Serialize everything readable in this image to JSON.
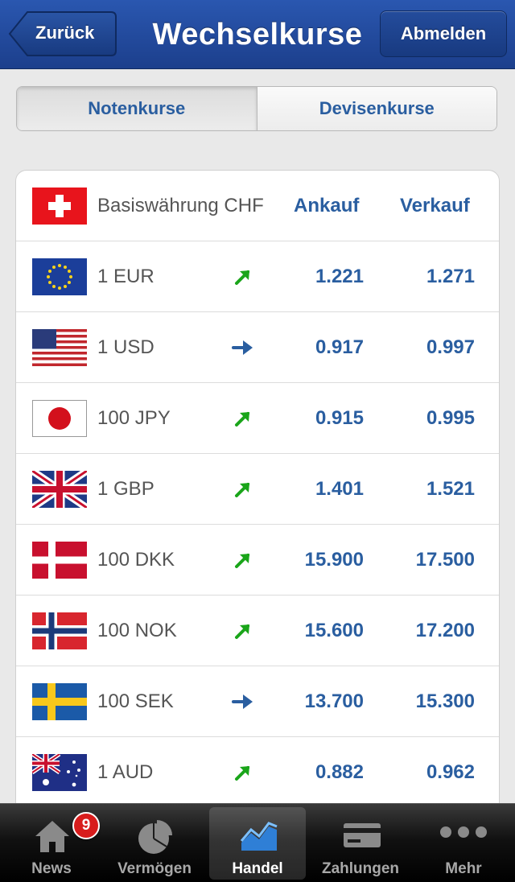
{
  "nav": {
    "title": "Wechselkurse",
    "back_label": "Zurück",
    "logout_label": "Abmelden"
  },
  "segments": [
    "Notenkurse",
    "Devisenkurse"
  ],
  "table": {
    "base_label": "Basiswährung CHF",
    "buy_header": "Ankauf",
    "sell_header": "Verkauf",
    "rows": [
      {
        "label": "1 EUR",
        "trend": "up",
        "buy": "1.221",
        "sell": "1.271"
      },
      {
        "label": "1 USD",
        "trend": "flat",
        "buy": "0.917",
        "sell": "0.997"
      },
      {
        "label": "100 JPY",
        "trend": "up",
        "buy": "0.915",
        "sell": "0.995"
      },
      {
        "label": "1 GBP",
        "trend": "up",
        "buy": "1.401",
        "sell": "1.521"
      },
      {
        "label": "100 DKK",
        "trend": "up",
        "buy": "15.900",
        "sell": "17.500"
      },
      {
        "label": "100 NOK",
        "trend": "up",
        "buy": "15.600",
        "sell": "17.200"
      },
      {
        "label": "100 SEK",
        "trend": "flat",
        "buy": "13.700",
        "sell": "15.300"
      },
      {
        "label": "1 AUD",
        "trend": "up",
        "buy": "0.882",
        "sell": "0.962"
      }
    ]
  },
  "tabbar": {
    "tabs": [
      {
        "label": "News",
        "icon": "home-icon"
      },
      {
        "label": "Vermögen",
        "icon": "pie-chart-icon"
      },
      {
        "label": "Handel",
        "icon": "trading-chart-icon"
      },
      {
        "label": "Zahlungen",
        "icon": "credit-card-icon"
      },
      {
        "label": "Mehr",
        "icon": "more-dots-icon"
      }
    ],
    "news_badge": "9",
    "active_tab": "Handel"
  },
  "colors": {
    "accent": "#2a5ea0",
    "trend_up": "#1aa51a",
    "trend_flat": "#2a5ea0",
    "nav": "#1f4a9e"
  }
}
